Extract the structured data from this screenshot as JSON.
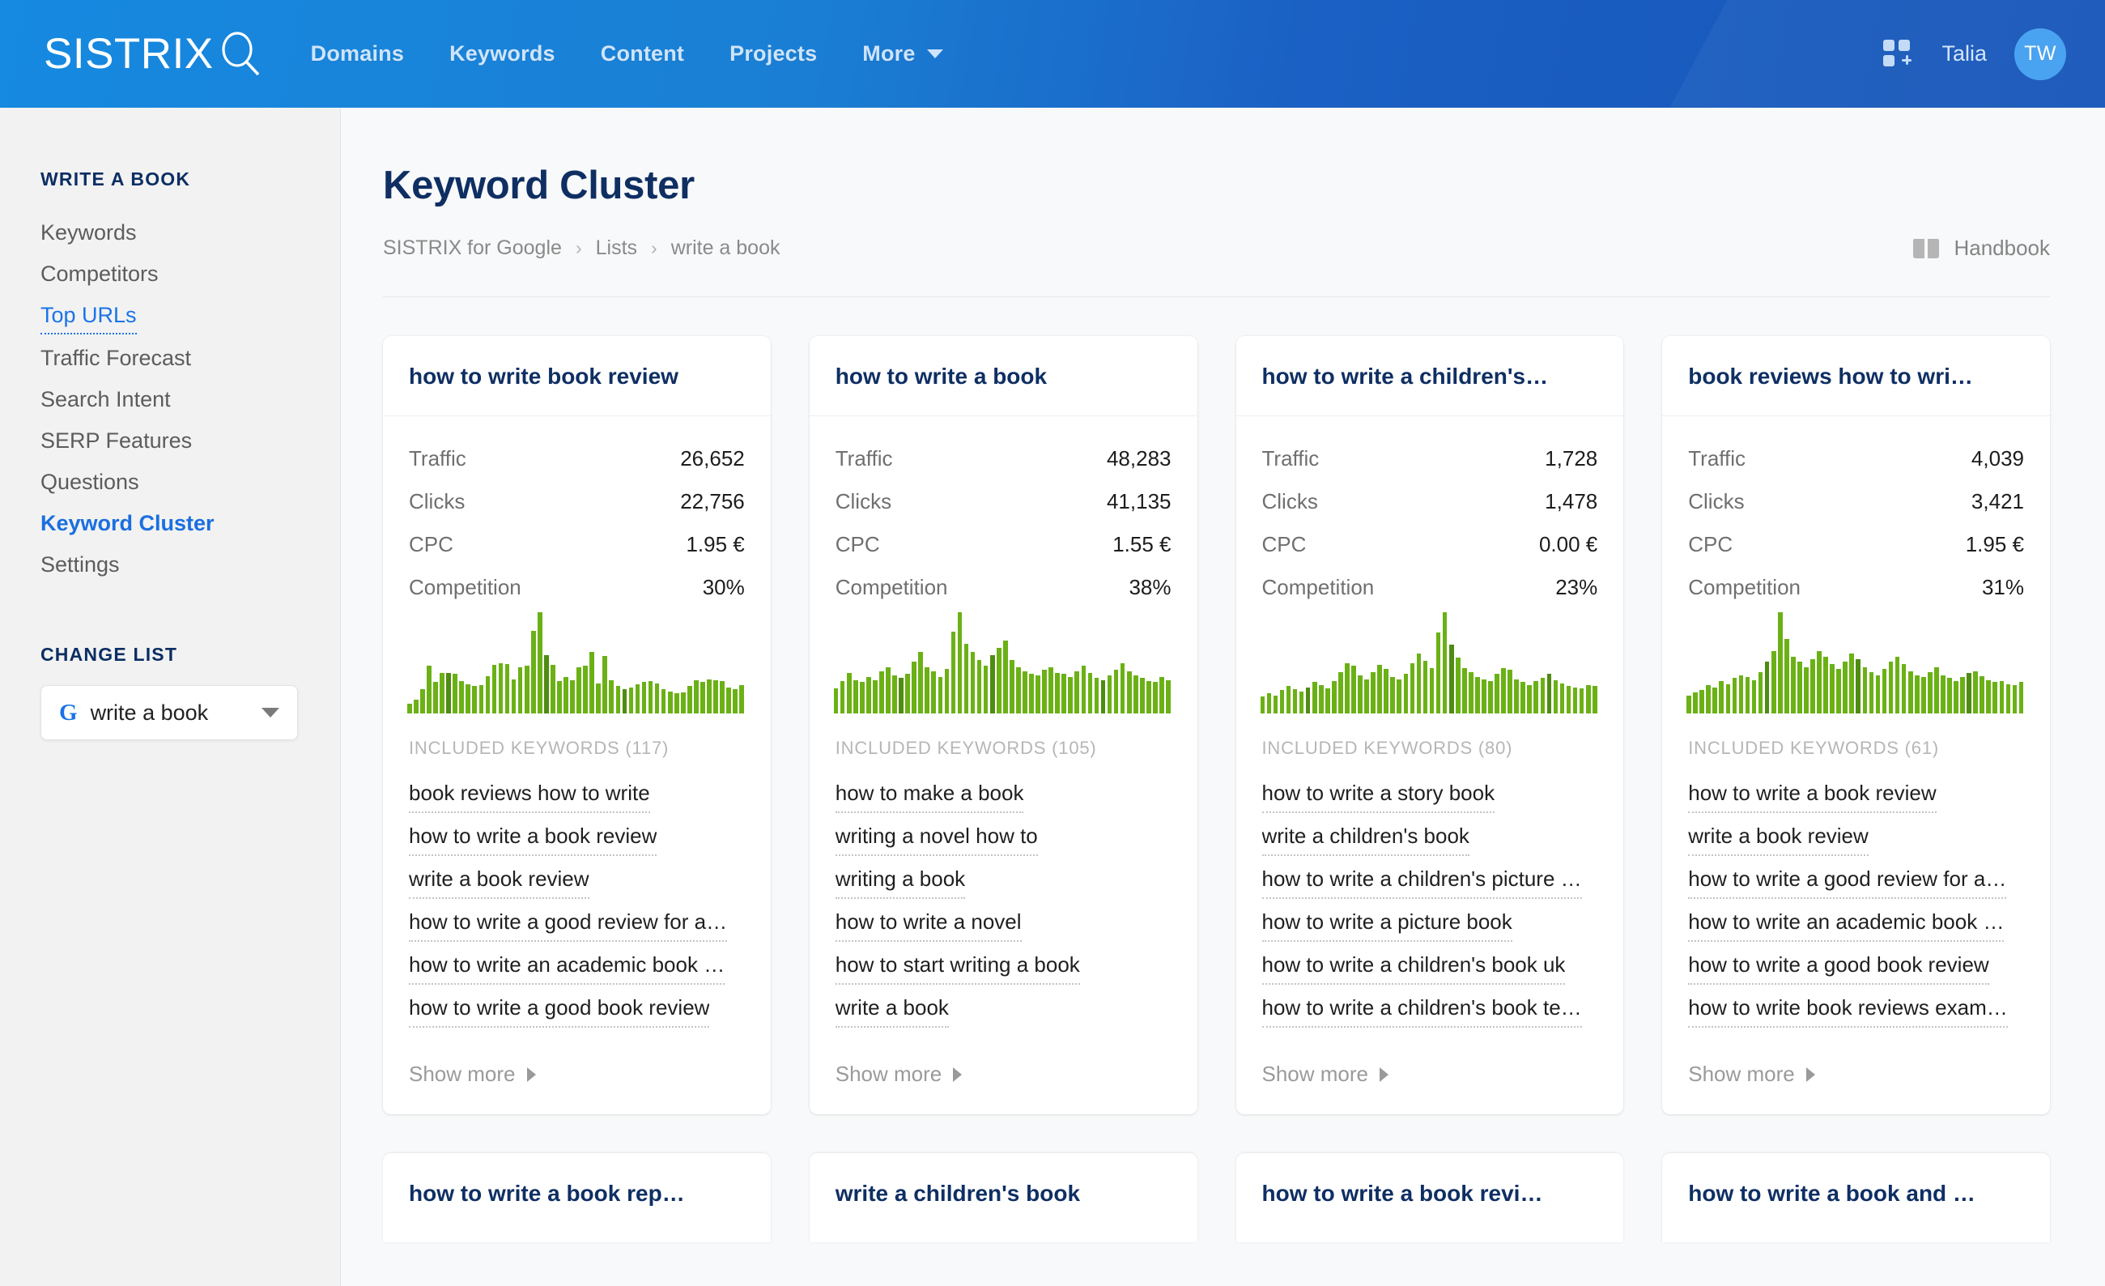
{
  "header": {
    "logo_text": "SISTRIX",
    "logo_icon": "magnifier-icon",
    "nav": [
      {
        "label": "Domains"
      },
      {
        "label": "Keywords"
      },
      {
        "label": "Content"
      },
      {
        "label": "Projects"
      },
      {
        "label": "More",
        "has_caret": true
      }
    ],
    "apps_icon": "apps-grid-add-icon",
    "user_name": "Talia",
    "avatar_initials": "TW",
    "brand_color": "#1689e0"
  },
  "sidebar": {
    "section_title": "WRITE A BOOK",
    "items": [
      {
        "label": "Keywords",
        "state": "normal"
      },
      {
        "label": "Competitors",
        "state": "normal"
      },
      {
        "label": "Top URLs",
        "state": "hovered"
      },
      {
        "label": "Traffic Forecast",
        "state": "normal"
      },
      {
        "label": "Search Intent",
        "state": "normal"
      },
      {
        "label": "SERP Features",
        "state": "normal"
      },
      {
        "label": "Questions",
        "state": "normal"
      },
      {
        "label": "Keyword Cluster",
        "state": "active"
      },
      {
        "label": "Settings",
        "state": "normal"
      }
    ],
    "change_list_title": "CHANGE LIST",
    "list_select": {
      "icon": "google-g-icon",
      "icon_letter": "G",
      "value": "write a book"
    }
  },
  "main": {
    "page_title": "Keyword Cluster",
    "breadcrumb": [
      "SISTRIX for Google",
      "Lists",
      "write a book"
    ],
    "breadcrumb_separator": "›",
    "handbook": {
      "icon": "book-icon",
      "label": "Handbook"
    },
    "stat_labels": {
      "traffic": "Traffic",
      "clicks": "Clicks",
      "cpc": "CPC",
      "competition": "Competition"
    },
    "included_keywords_prefix": "INCLUDED KEYWORDS",
    "show_more_label": "Show more"
  },
  "cards": [
    {
      "title": "how to write book review",
      "traffic": "26,652",
      "clicks": "22,756",
      "cpc": "1.95 €",
      "competition": "30%",
      "included_count": "117",
      "included_label": "INCLUDED KEYWORDS (117)",
      "keywords": [
        "book reviews how to write",
        "how to write a book review",
        "write a book review",
        "how to write a good review for a…",
        "how to write an academic book …",
        "how to write a good book review"
      ]
    },
    {
      "title": "how to write a book",
      "traffic": "48,283",
      "clicks": "41,135",
      "cpc": "1.55 €",
      "competition": "38%",
      "included_count": "105",
      "included_label": "INCLUDED KEYWORDS (105)",
      "keywords": [
        "how to make a book",
        "writing a novel how to",
        "writing a book",
        "how to write a novel",
        "how to start writing a book",
        "write a book"
      ]
    },
    {
      "title": "how to write a children's…",
      "traffic": "1,728",
      "clicks": "1,478",
      "cpc": "0.00 €",
      "competition": "23%",
      "included_count": "80",
      "included_label": "INCLUDED KEYWORDS (80)",
      "keywords": [
        "how to write a story book",
        "write a children's book",
        "how to write a children's picture …",
        "how to write a picture book",
        "how to write a children's book uk",
        "how to write a children's book te…"
      ]
    },
    {
      "title": "book reviews how to wri…",
      "traffic": "4,039",
      "clicks": "3,421",
      "cpc": "1.95 €",
      "competition": "31%",
      "included_count": "61",
      "included_label": "INCLUDED KEYWORDS (61)",
      "keywords": [
        "how to write a book review",
        "write a book review",
        "how to write a good review for a…",
        "how to write an academic book …",
        "how to write a good book review",
        "how to write book reviews exam…"
      ]
    }
  ],
  "cards_row2": [
    {
      "title": "how to write a book rep…"
    },
    {
      "title": "write a children's book"
    },
    {
      "title": "how to write a book revi…"
    },
    {
      "title": "how to write a book and …"
    }
  ],
  "chart_data": [
    {
      "type": "bar",
      "title": "how to write book review — search volume trend",
      "xlabel": "",
      "ylabel": "",
      "grid": false,
      "legend": false,
      "bar_color": "#6bb116",
      "alt_bar_color": "#4f8c12",
      "values": [
        9,
        13,
        22,
        42,
        28,
        36,
        36,
        35,
        29,
        26,
        24,
        25,
        33,
        43,
        45,
        44,
        31,
        41,
        42,
        74,
        90,
        52,
        43,
        29,
        32,
        30,
        41,
        42,
        55,
        27,
        51,
        30,
        24,
        22,
        23,
        26,
        28,
        29,
        27,
        22,
        20,
        18,
        19,
        24,
        30,
        28,
        31,
        30,
        29,
        23,
        22,
        25
      ],
      "dark_indices": [
        6,
        21,
        33
      ]
    },
    {
      "type": "bar",
      "title": "how to write a book — search volume trend",
      "bar_color": "#6bb116",
      "alt_bar_color": "#4f8c12",
      "values": [
        18,
        23,
        29,
        24,
        22,
        26,
        24,
        30,
        33,
        27,
        25,
        28,
        37,
        44,
        33,
        30,
        26,
        32,
        58,
        72,
        50,
        44,
        38,
        34,
        42,
        47,
        52,
        38,
        33,
        30,
        28,
        27,
        31,
        33,
        29,
        28,
        26,
        30,
        34,
        29,
        25,
        24,
        27,
        31,
        36,
        30,
        27,
        25,
        23,
        22,
        26,
        24
      ],
      "dark_indices": [
        10,
        24,
        41
      ]
    },
    {
      "type": "bar",
      "title": "how to write a children's book — search volume trend",
      "bar_color": "#6bb116",
      "alt_bar_color": "#4f8c12",
      "values": [
        15,
        18,
        16,
        20,
        24,
        21,
        19,
        23,
        27,
        25,
        22,
        28,
        36,
        44,
        41,
        33,
        30,
        36,
        42,
        39,
        32,
        30,
        34,
        44,
        52,
        46,
        40,
        70,
        88,
        60,
        48,
        40,
        36,
        32,
        30,
        28,
        34,
        40,
        38,
        30,
        27,
        25,
        28,
        31,
        34,
        29,
        26,
        24,
        23,
        22,
        25,
        24
      ],
      "dark_indices": [
        7,
        29,
        44
      ]
    },
    {
      "type": "bar",
      "title": "book reviews how to write — search volume trend",
      "bar_color": "#6bb116",
      "alt_bar_color": "#4f8c12",
      "values": [
        14,
        16,
        18,
        22,
        20,
        25,
        23,
        27,
        30,
        28,
        26,
        32,
        40,
        48,
        78,
        58,
        44,
        40,
        36,
        42,
        48,
        44,
        38,
        34,
        40,
        46,
        42,
        36,
        32,
        30,
        34,
        40,
        44,
        38,
        33,
        30,
        28,
        32,
        36,
        30,
        27,
        25,
        28,
        31,
        33,
        29,
        26,
        24,
        25,
        23,
        22,
        24
      ],
      "dark_indices": [
        12,
        26,
        43
      ]
    }
  ]
}
